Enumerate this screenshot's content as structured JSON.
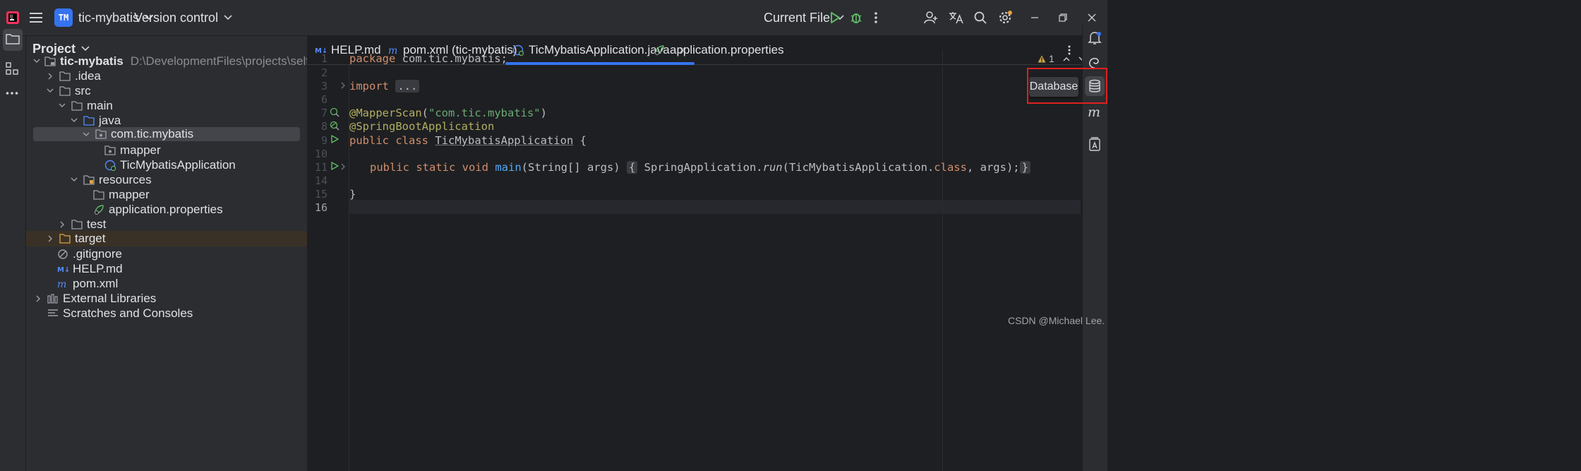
{
  "titlebar": {
    "project_badge": "TM",
    "project_name": "tic-mybatis",
    "vcs_label": "Version control",
    "run_config": "Current File"
  },
  "project_panel": {
    "title": "Project",
    "root_name": "tic-mybatis",
    "root_path": "D:\\DevelopmentFiles\\projects\\self_projects\\tic-myb",
    "items": [
      {
        "label": "tic-mybatis"
      },
      {
        "label": ".idea"
      },
      {
        "label": "src"
      },
      {
        "label": "main"
      },
      {
        "label": "java"
      },
      {
        "label": "com.tic.mybatis"
      },
      {
        "label": "mapper"
      },
      {
        "label": "TicMybatisApplication"
      },
      {
        "label": "resources"
      },
      {
        "label": "mapper"
      },
      {
        "label": "application.properties"
      },
      {
        "label": "test"
      },
      {
        "label": "target"
      },
      {
        "label": ".gitignore"
      },
      {
        "label": "HELP.md"
      },
      {
        "label": "pom.xml"
      },
      {
        "label": "External Libraries"
      },
      {
        "label": "Scratches and Consoles"
      }
    ]
  },
  "tabs": [
    {
      "label": "HELP.md",
      "icon": "markdown-icon"
    },
    {
      "label": "pom.xml (tic-mybatis)",
      "icon": "maven-icon"
    },
    {
      "label": "TicMybatisApplication.java",
      "icon": "spring-class-icon",
      "active": true
    },
    {
      "label": "application.properties",
      "icon": "spring-properties-icon"
    }
  ],
  "editor": {
    "line_numbers": [
      "1",
      "2",
      "3",
      "6",
      "7",
      "8",
      "9",
      "10",
      "11",
      "14",
      "15",
      "16"
    ],
    "warning_count": "1",
    "code": {
      "l1_kw": "package",
      "l1_rest": " com.tic.mybatis;",
      "l3_kw": "import",
      "l3_fold": "...",
      "l7_ann": "@MapperScan",
      "l7_p1": "(",
      "l7_str": "\"com.tic.mybatis\"",
      "l7_p2": ")",
      "l8_ann": "@SpringBootApplication",
      "l9_kw": "public class",
      "l9_name": "TicMybatisApplication",
      "l9_rest": " {",
      "l11_kw": "public static void",
      "l11_fn": "main",
      "l11_args": "(String[] args)",
      "l11_fold1": "{",
      "l11_call": " SpringApplication.",
      "l11_run": "run",
      "l11_p": "(TicMybatisApplication.",
      "l11_class": "class",
      "l11_end": ", args);",
      "l11_fold2": "}",
      "l15": "}"
    }
  },
  "right_toolbar": {
    "items": [
      "notifications-icon",
      "ai-assistant-icon",
      "database-icon",
      "maven-icon",
      "translate-icon"
    ]
  },
  "tooltip": "Database",
  "watermark": "CSDN @Michael Lee."
}
